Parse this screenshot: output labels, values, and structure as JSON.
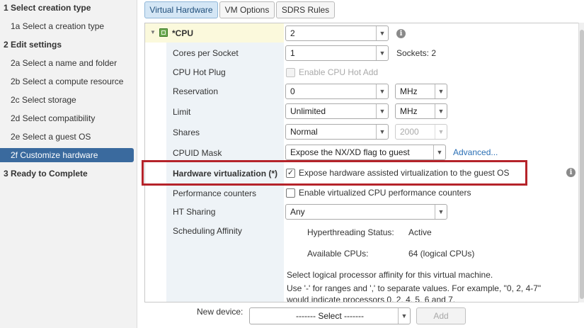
{
  "wizard": {
    "steps": [
      {
        "label": "1  Select creation type"
      },
      {
        "label": "1a  Select a creation type"
      },
      {
        "label": "2  Edit settings"
      },
      {
        "label": "2a  Select a name and folder"
      },
      {
        "label": "2b  Select a compute resource"
      },
      {
        "label": "2c  Select storage"
      },
      {
        "label": "2d  Select compatibility"
      },
      {
        "label": "2e  Select a guest OS"
      },
      {
        "label": "2f  Customize hardware"
      },
      {
        "label": "3  Ready to Complete"
      }
    ]
  },
  "tabs": [
    {
      "label": "Virtual Hardware"
    },
    {
      "label": "VM Options"
    },
    {
      "label": "SDRS Rules"
    }
  ],
  "cpu": {
    "title": "*CPU",
    "count_value": "2",
    "cores_label": "Cores per Socket",
    "cores_value": "1",
    "sockets_text": "Sockets:  2",
    "hotplug_label": "CPU Hot Plug",
    "hotplug_option": "Enable CPU Hot Add",
    "reservation_label": "Reservation",
    "reservation_value": "0",
    "reservation_unit": "MHz",
    "limit_label": "Limit",
    "limit_value": "Unlimited",
    "limit_unit": "MHz",
    "shares_label": "Shares",
    "shares_value": "Normal",
    "shares_number": "2000",
    "cpuid_label": "CPUID Mask",
    "cpuid_value": "Expose the NX/XD flag to guest",
    "cpuid_link": "Advanced...",
    "hwvirt_label": "Hardware virtualization (*)",
    "hwvirt_option": "Expose hardware assisted virtualization to the guest OS",
    "perf_label": "Performance counters",
    "perf_option": "Enable virtualized CPU performance counters",
    "ht_label": "HT Sharing",
    "ht_value": "Any",
    "affinity_label": "Scheduling Affinity",
    "ht_status_label": "Hyperthreading Status:",
    "ht_status_value": "Active",
    "avail_cpus_label": "Available CPUs:",
    "avail_cpus_value": "64 (logical CPUs)",
    "affinity_help_1": "Select logical processor affinity for this virtual machine.",
    "affinity_help_2": "Use '-' for ranges and ',' to separate values. For example,  \"0, 2, 4-7\"",
    "affinity_help_3": "would indicate processors 0, 2, 4, 5, 6 and 7."
  },
  "footer": {
    "new_device_label": "New device:",
    "select_value": "------- Select -------",
    "add_label": "Add"
  },
  "icons": {
    "expand": "triangle-down-icon",
    "cpu": "cpu-chip-icon",
    "info": "info-icon",
    "dropdown": "chevron-down-icon",
    "check": "checkmark-icon"
  },
  "colors": {
    "nav_active": "#3a6a9e",
    "highlight_border": "#b5232a",
    "tab_active": "#d4e6f5",
    "label_column": "#eef3f7",
    "link": "#2a6fb5"
  }
}
